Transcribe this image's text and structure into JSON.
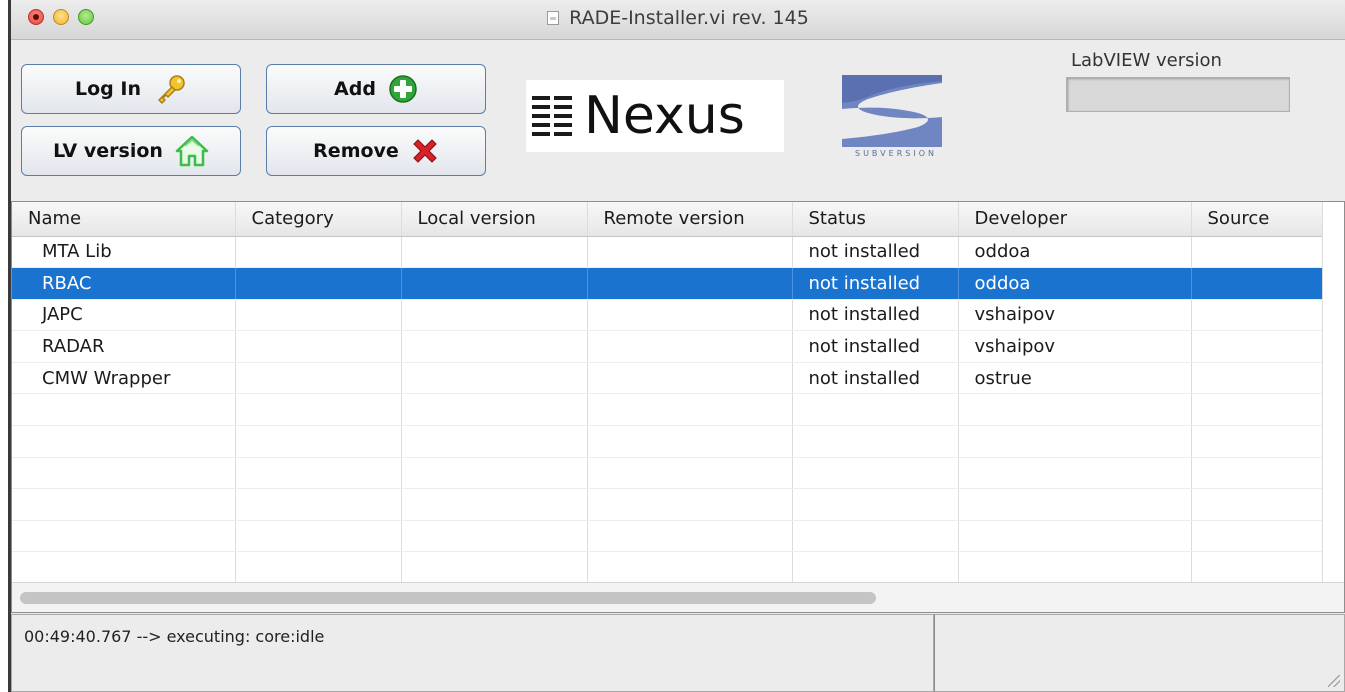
{
  "window": {
    "title": "RADE-Installer.vi rev. 145"
  },
  "toolbar": {
    "login_label": "Log In",
    "lv_version_label": "LV version",
    "add_label": "Add",
    "remove_label": "Remove",
    "nexus_text": "Nexus",
    "subversion_text": "SUBVERSION"
  },
  "labview": {
    "label": "LabVIEW version",
    "value": ""
  },
  "table": {
    "columns": [
      "Name",
      "Category",
      "Local version",
      "Remote version",
      "Status",
      "Developer",
      "Source"
    ],
    "rows": [
      {
        "name": "MTA Lib",
        "category": "",
        "local": "",
        "remote": "",
        "status": "not installed",
        "developer": "oddoa",
        "source": ""
      },
      {
        "name": "RBAC",
        "category": "",
        "local": "",
        "remote": "",
        "status": "not installed",
        "developer": "oddoa",
        "source": ""
      },
      {
        "name": "JAPC",
        "category": "",
        "local": "",
        "remote": "",
        "status": "not installed",
        "developer": "vshaipov",
        "source": ""
      },
      {
        "name": "RADAR",
        "category": "",
        "local": "",
        "remote": "",
        "status": "not installed",
        "developer": "vshaipov",
        "source": ""
      },
      {
        "name": "CMW Wrapper",
        "category": "",
        "local": "",
        "remote": "",
        "status": "not installed",
        "developer": "ostrue",
        "source": ""
      }
    ],
    "selected_row": "RBAC"
  },
  "status": {
    "message": "00:49:40.767 --> executing: core:idle"
  },
  "icons": {
    "login": "key-icon",
    "lv_version": "home-icon",
    "add": "plus-icon",
    "remove": "x-icon"
  },
  "colors": {
    "selection": "#1a74cf",
    "add_icon": "#2fa53a",
    "remove_icon": "#d8222a",
    "key_icon": "#f2c32a",
    "home_icon": "#3bbd4a"
  }
}
